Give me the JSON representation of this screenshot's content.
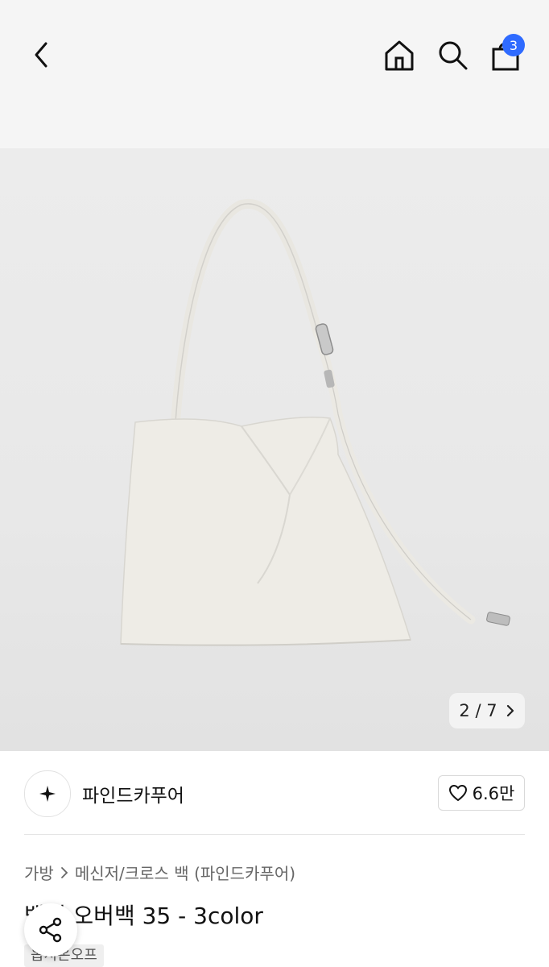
{
  "header": {
    "cart_count": "3"
  },
  "gallery": {
    "current": "2",
    "separator": "/",
    "total": "7"
  },
  "brand": {
    "name": "파인드카푸어",
    "likes": "6.6만"
  },
  "breadcrumb": {
    "level1": "가방",
    "level2": "메신저/크로스 백 (파인드카푸어)"
  },
  "product": {
    "title": "백팩 오버백 35 - 3color",
    "tag": "옵시온오프"
  },
  "icons": [
    "back-icon",
    "home-icon",
    "search-icon",
    "shopping-bag-icon",
    "chevron-right-icon",
    "heart-icon",
    "share-icon"
  ],
  "colors": {
    "badge": "#2f6bff",
    "topbar": "#f5f5f5",
    "hero": "#e8e8e8"
  }
}
